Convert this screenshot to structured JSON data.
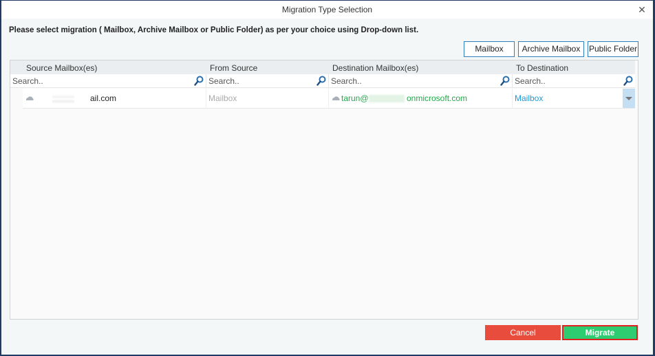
{
  "window": {
    "title": "Migration Type Selection",
    "close_label": "X"
  },
  "instruction": "Please select migration ( Mailbox, Archive Mailbox or Public Folder) as per your choice using Drop-down list.",
  "type_buttons": [
    {
      "label": "Mailbox"
    },
    {
      "label": "Archive Mailbox"
    },
    {
      "label": "Public Folder"
    }
  ],
  "grid": {
    "columns": [
      {
        "header": "Source Mailbox(es)",
        "search_placeholder": "Search.."
      },
      {
        "header": "From Source",
        "search_placeholder": "Search.."
      },
      {
        "header": "Destination Mailbox(es)",
        "search_placeholder": "Search.."
      },
      {
        "header": "To Destination",
        "search_placeholder": "Search.."
      }
    ],
    "rows": [
      {
        "source_visible": "ail.com",
        "from_source": "Mailbox",
        "destination_prefix": "tarun@",
        "destination_suffix": "onmicrosoft.com",
        "to_destination": "Mailbox"
      }
    ]
  },
  "footer": {
    "cancel_label": "Cancel",
    "migrate_label": "Migrate"
  },
  "colors": {
    "border": "#1f3b63",
    "accent_blue": "#2f7fbf",
    "destination_text": "#22a84a",
    "to_destination_text": "#1a9ad6",
    "cancel_bg": "#e74c3c",
    "migrate_bg": "#2ecc71",
    "migrate_outline": "#e02020"
  }
}
